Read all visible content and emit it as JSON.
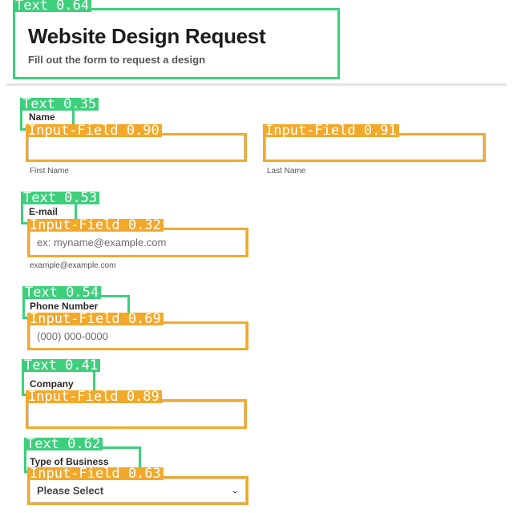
{
  "form": {
    "title": "Website Design Request",
    "subtitle": "Fill out the form to request a design",
    "name_label": "Name",
    "first_name_sublabel": "First Name",
    "last_name_sublabel": "Last Name",
    "email_label": "E-mail",
    "email_placeholder": "ex: myname@example.com",
    "email_sublabel": "example@example.com",
    "phone_label": "Phone Number",
    "phone_placeholder": "(000) 000-0000",
    "company_label": "Company",
    "business_type_label": "Type of Business",
    "business_type_selected": "Please Select",
    "business_type_icon": "chevron-down-icon"
  },
  "detections": [
    {
      "label": "Text 0.64"
    },
    {
      "label": "Text 0.35"
    },
    {
      "label": "Input-Field 0.90"
    },
    {
      "label": "Input-Field 0.91"
    },
    {
      "label": "Text 0.53"
    },
    {
      "label": "Input-Field 0.32"
    },
    {
      "label": "Text 0.54"
    },
    {
      "label": "Input-Field 0.69"
    },
    {
      "label": "Text 0.41"
    },
    {
      "label": "Input-Field 0.89"
    },
    {
      "label": "Text 0.62"
    },
    {
      "label": "Input-Field 0.63"
    }
  ],
  "colors": {
    "text_box": "#3ecf7c",
    "input_box": "#f2a92b"
  }
}
